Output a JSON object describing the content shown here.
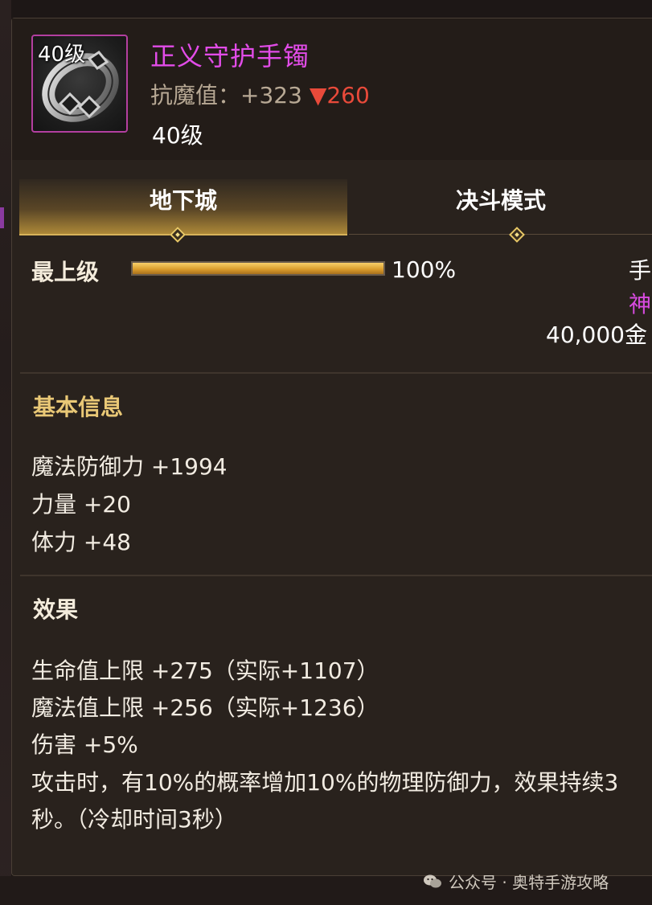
{
  "item": {
    "name": "正义守护手镯",
    "icon_level": "40级",
    "stat_label": "抗魔值：",
    "stat_value": "+323",
    "stat_diff": "▼260",
    "level": "40级",
    "icon": "bracelet-icon",
    "rarity_color": "#e24ce8"
  },
  "tabs": [
    {
      "label": "地下城",
      "active": true
    },
    {
      "label": "决斗模式",
      "active": false
    }
  ],
  "grade": {
    "label": "最上级",
    "progress": 1.0,
    "percent_text": "100%"
  },
  "right_info": {
    "line1": "手",
    "line2": "神",
    "line3": "40,000金"
  },
  "basic_info": {
    "title": "基本信息",
    "lines": [
      "魔法防御力 +1994",
      "力量 +20",
      "体力 +48"
    ]
  },
  "effects": {
    "title": "效果",
    "lines": [
      "生命值上限 +275（实际+1107）",
      "魔法值上限 +256（实际+1236）",
      "伤害 +5%",
      "攻击时，有10%的概率增加10%的物理防御力，效果持续3",
      "秒。（冷却时间3秒）"
    ]
  },
  "watermark": {
    "text": "公众号 · 奥特手游攻略",
    "icon": "wechat-icon"
  },
  "colors": {
    "accent_gold": "#e9c876",
    "diff_red": "#e94a3a",
    "epic_purple": "#e24ce8"
  }
}
